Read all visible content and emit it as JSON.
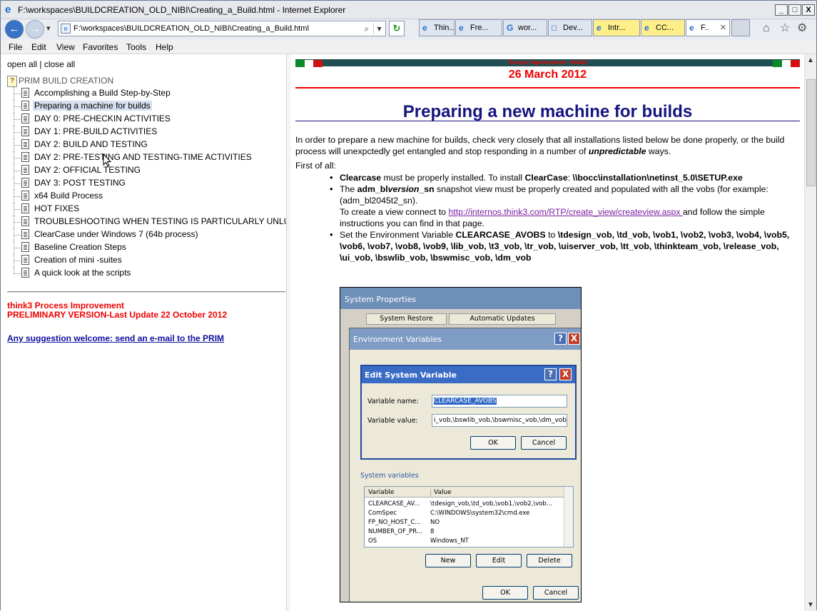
{
  "window": {
    "title": "F:\\workspaces\\BUILDCREATION_OLD_NIBI\\Creating_a_Build.html - Internet Explorer",
    "minimize": "_",
    "restore": "□",
    "close": "X"
  },
  "nav": {
    "back": "←",
    "forward": "→",
    "dropdown": "▾",
    "address": "F:\\workspaces\\BUILDCREATION_OLD_NIBI\\Creating_a_Build.html",
    "search_icon": "⌕",
    "address_dropdown": "▾",
    "refresh": "↻",
    "home_icon": "⌂",
    "favorites_icon": "☆",
    "tools_icon": "⚙"
  },
  "tabs": [
    {
      "label": "Thin...",
      "icon": "e",
      "style": "normal"
    },
    {
      "label": "Fre...",
      "icon": "e",
      "style": "normal"
    },
    {
      "label": "wor...",
      "icon": "G",
      "style": "normal"
    },
    {
      "label": "Dev...",
      "icon": "□",
      "style": "normal"
    },
    {
      "label": "Intr...",
      "icon": "e",
      "style": "y"
    },
    {
      "label": "CC...",
      "icon": "e",
      "style": "y"
    },
    {
      "label": "F..",
      "icon": "e",
      "style": "active",
      "close": "✕"
    }
  ],
  "menu": [
    "File",
    "Edit",
    "View",
    "Favorites",
    "Tools",
    "Help"
  ],
  "toc": {
    "open_all": "open all",
    "sep": " | ",
    "close_all": "close all",
    "root": "PRIM BUILD CREATION",
    "root_icon": "?",
    "items": [
      "Accomplishing a Build Step-by-Step",
      "Preparing a machine for builds",
      "DAY 0: PRE-CHECKIN ACTIVITIES",
      "DAY 1: PRE-BUILD ACTIVITIES",
      "DAY 2: BUILD AND TESTING",
      "DAY 2: PRE-TESTING AND TESTING-TIME ACTIVITIES",
      "DAY 2: OFFICIAL TESTING",
      "DAY 3: POST TESTING",
      "x64 Build Process",
      "HOT FIXES",
      "TROUBLESHOOTING WHEN TESTING IS PARTICULARLY UNLUCKY",
      "ClearCase under Windows 7 (64b process)",
      "Baseline Creation Steps",
      "Creation of mini -suites",
      "A quick look at the scripts"
    ],
    "selected_index": 1,
    "footer_line1": "think3 Process Improvement",
    "footer_line2": "PRELIMINARY VERSION-Last Update 22 October 2012",
    "footer_link": "Any suggestion welcome: send an e-mail to the PRIM"
  },
  "doc": {
    "banner_text": "Process Improvement - think3",
    "date": "26 March 2012",
    "heading": "Preparing a new machine for builds",
    "intro_a": "In order to prepare a new machine for builds, check very closely that all installations listed below be done properly, or the build process will unexpctedly get entangled and stop responding in a number of ",
    "intro_em": "unpredictable",
    "intro_b": " ways.",
    "first_of_all": "First of all:",
    "b1_bold": "Clearcase",
    "b1_text": " must be properly installed. To install ",
    "b1_bold2": "ClearCase",
    "b1_text2": ": ",
    "b1_path": "\\\\bocc\\installation\\netinst_5.0\\SETUP.exe",
    "b2_pre": "The ",
    "b2_bold": "adm_bl",
    "b2_em": "version",
    "b2_bold2": "_sn",
    "b2_text": " snapshot view must be properly created and populated with all the vobs (for example: (adm_bl2045t2_sn).",
    "b2_line2_pre": "To create a view connect to ",
    "b2_link": "http://internos.think3.com/RTP/create_view/createview.aspx ",
    "b2_line2_post": "and follow the simple instructions you can find in that page.",
    "b3_pre": "Set the Environment Variable ",
    "b3_bold": "CLEARCASE_AVOBS",
    "b3_mid": " to ",
    "b3_vobs": "\\tdesign_vob, \\td_vob, \\vob1, \\vob2, \\vob3, \\vob4, \\vob5, \\vob6, \\vob7, \\vob8, \\vob9, \\lib_vob, \\t3_vob, \\tr_vob, \\uiserver_vob, \\tt_vob, \\thinkteam_vob, \\release_vob, \\ui_vob, \\bswlib_vob, \\bswmisc_vob, \\dm_vob"
  },
  "screenshot": {
    "sysprops_title": "System Properties",
    "tab1": "System Restore",
    "tab2": "Automatic Updates",
    "env_title": "Environment Variables",
    "edit_title": "Edit System Variable",
    "help": "?",
    "close": "X",
    "var_name_label": "Variable name:",
    "var_name_value": "CLEARCASE_AVOBS",
    "var_value_label": "Variable value:",
    "var_value_value": "i_vob,\\bswlib_vob,\\bswmisc_vob,\\dm_vob",
    "ok": "OK",
    "cancel": "Cancel",
    "system_variables": "System variables",
    "col_variable": "Variable",
    "col_value": "Value",
    "rows": [
      {
        "name": "CLEARCASE_AV...",
        "value": "\\tdesign_vob,\\td_vob,\\vob1,\\vob2,\\vob..."
      },
      {
        "name": "ComSpec",
        "value": "C:\\WINDOWS\\system32\\cmd.exe"
      },
      {
        "name": "FP_NO_HOST_C...",
        "value": "NO"
      },
      {
        "name": "NUMBER_OF_PR...",
        "value": "8"
      },
      {
        "name": "OS",
        "value": "Windows_NT"
      }
    ],
    "new": "New",
    "edit": "Edit",
    "delete": "Delete",
    "ok2": "OK",
    "cancel2": "Cancel"
  },
  "scrollbar": {
    "up": "▲",
    "down": "▼"
  },
  "colors": {
    "accent_red": "#e00000",
    "heading_blue": "#141480",
    "banner_teal": "#1f4f53"
  }
}
